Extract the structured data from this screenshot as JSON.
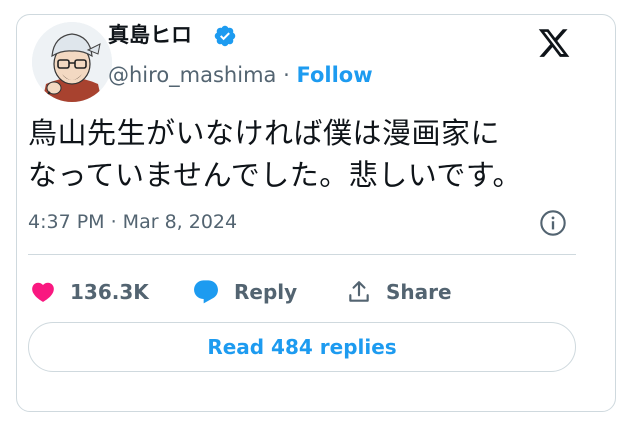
{
  "author": {
    "display_name": "真島ヒロ",
    "handle": "@hiro_mashima",
    "separator": "·",
    "follow_label": "Follow",
    "verified": true,
    "verified_color": "#1d9bf0"
  },
  "tweet": {
    "text_line1": "鳥山先生がいなければ僕は漫画家に",
    "text_line2": "なっていませんでした。悲しいです。",
    "timestamp": "4:37 PM · Mar 8, 2024"
  },
  "actions": {
    "like_count": "136.3K",
    "like_color": "#f91880",
    "reply_label": "Reply",
    "reply_color": "#1d9bf0",
    "share_label": "Share"
  },
  "read_replies_label": "Read 484 replies",
  "icons": {
    "brand": "x-logo-icon",
    "info": "info-icon",
    "like": "heart-icon",
    "reply": "speech-bubble-icon",
    "share": "share-upload-icon"
  },
  "colors": {
    "text_primary": "#0f1419",
    "text_secondary": "#536471",
    "accent": "#1d9bf0",
    "border": "#cfd9de"
  }
}
